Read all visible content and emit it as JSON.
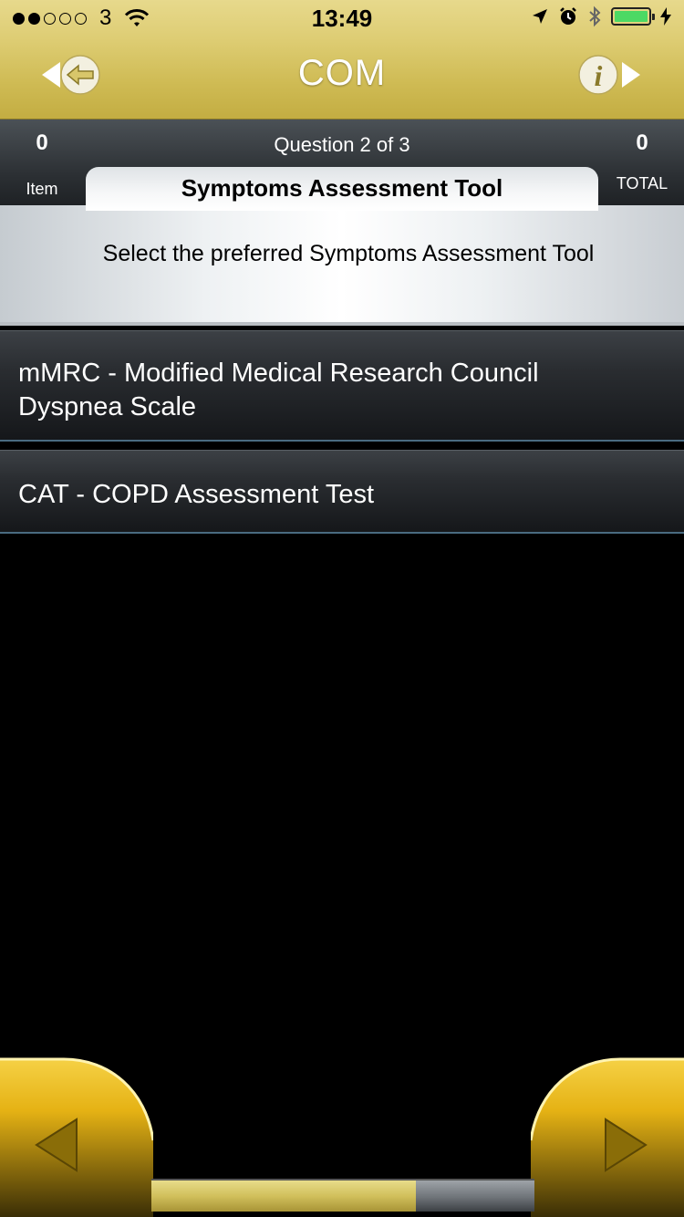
{
  "status_bar": {
    "carrier": "3",
    "time": "13:49",
    "signal_strength": 2,
    "signal_max": 5,
    "battery_color": "#4cd964"
  },
  "nav": {
    "title": "COM",
    "back_icon": "back-arrow-icon",
    "info_icon": "info-icon"
  },
  "question_bar": {
    "item_count": "0",
    "item_label": "Item",
    "total_count": "0",
    "total_label": "TOTAL",
    "counter": "Question 2 of 3"
  },
  "card": {
    "title": "Symptoms Assessment Tool",
    "prompt": "Select the preferred Symptoms Assessment Tool"
  },
  "options": [
    {
      "label": "mMRC - Modified Medical Research Council Dyspnea Scale"
    },
    {
      "label": "CAT - COPD Assessment Test"
    }
  ],
  "footer": {
    "progress_fraction": 0.69,
    "prev_icon": "prev-triangle-icon",
    "next_icon": "next-triangle-icon"
  },
  "colors": {
    "header_gold": "#d8c66a",
    "button_gold": "#f2c21c",
    "dark_bar": "#2c3034",
    "progress_gold": "#d1c05c",
    "progress_grey": "#6e7378"
  }
}
